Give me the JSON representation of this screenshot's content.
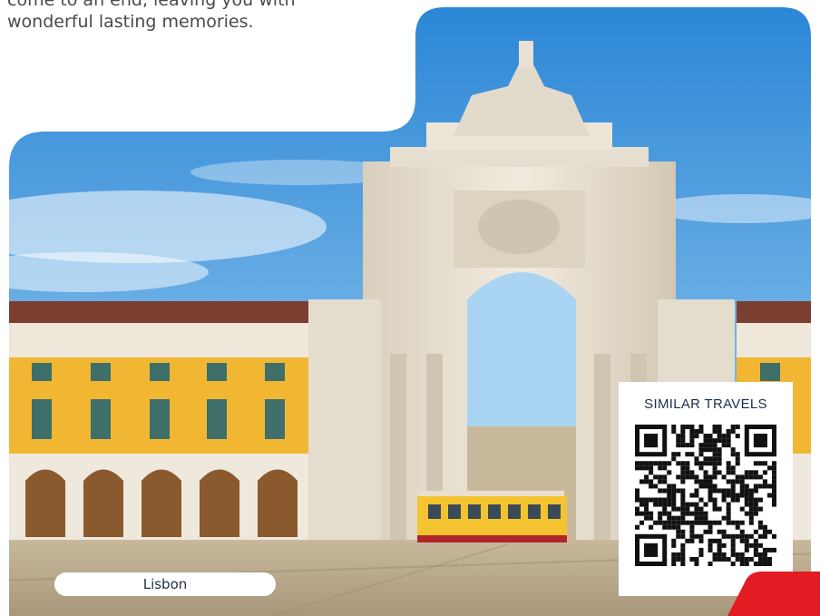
{
  "intro": {
    "lines": [
      "come to an end, leaving you with",
      "wonderful lasting memories."
    ]
  },
  "photo": {
    "subject": "Rua Augusta Arch, Praça do Comércio, Lisbon",
    "colors": {
      "sky_top": "#2a86d6",
      "sky_bottom": "#9fd0f2",
      "arch_stone": "#e9e1d2",
      "building_yellow": "#f1b733",
      "roof": "#7a3f2e",
      "tram_yellow": "#f4c430",
      "plaza": "#b9a98f"
    }
  },
  "qr": {
    "title": "SIMILAR TRAVELS",
    "icon": "qr-code-icon"
  },
  "location": {
    "label": "Lisbon"
  },
  "accent": {
    "color": "#e31b23"
  }
}
